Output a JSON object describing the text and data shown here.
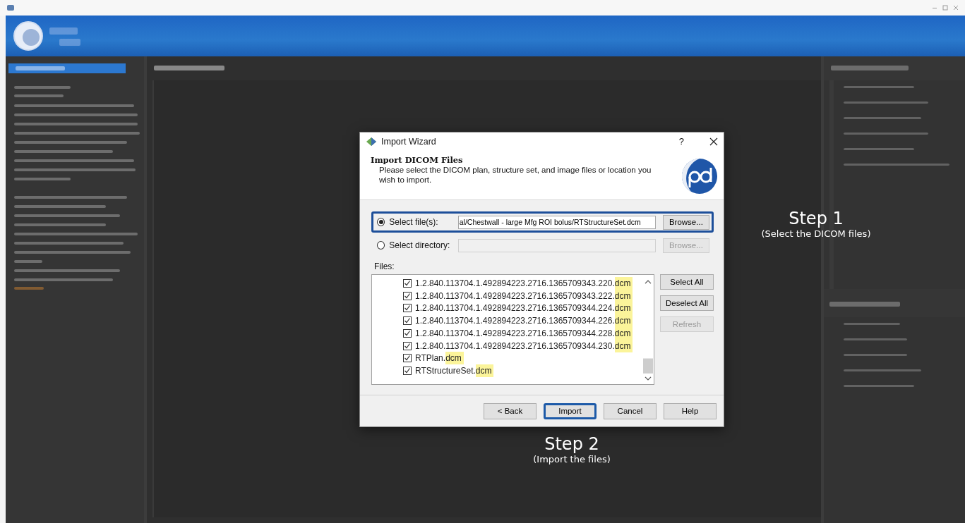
{
  "window": {
    "title": "Import Wizard",
    "help_glyph": "?"
  },
  "header": {
    "title": "Import DICOM Files",
    "description": "Please select the DICOM plan, structure set, and image files or location you wish to import."
  },
  "sources": [
    {
      "label": "Select file(s):",
      "selected": true,
      "value": "al/Chestwall - large Mfg ROI bolus/RTStructureSet.dcm",
      "browse": "Browse...",
      "disabled": false,
      "outlined": true
    },
    {
      "label": "Select directory:",
      "selected": false,
      "browse": "Browse...",
      "disabled": true,
      "outlined": false
    }
  ],
  "files_label": "Files:",
  "files": [
    {
      "name": "1.2.840.113704.1.492894223.2716.1365709343.220.",
      "highlight": "dcm",
      "checked": true
    },
    {
      "name": "1.2.840.113704.1.492894223.2716.1365709343.222.",
      "highlight": "dcm",
      "checked": true
    },
    {
      "name": "1.2.840.113704.1.492894223.2716.1365709344.224.",
      "highlight": "dcm",
      "checked": true
    },
    {
      "name": "1.2.840.113704.1.492894223.2716.1365709344.226.",
      "highlight": "dcm",
      "checked": true
    },
    {
      "name": "1.2.840.113704.1.492894223.2716.1365709344.228.",
      "highlight": "dcm",
      "checked": true
    },
    {
      "name": "1.2.840.113704.1.492894223.2716.1365709344.230.",
      "highlight": "dcm",
      "checked": true
    },
    {
      "name": "RTPlan.",
      "highlight": "dcm",
      "checked": true
    },
    {
      "name": "RTStructureSet.",
      "highlight": "dcm",
      "checked": true
    }
  ],
  "list_buttons": [
    {
      "label": "Select All",
      "disabled": false
    },
    {
      "label": "Deselect All",
      "disabled": false
    },
    {
      "label": "Refresh",
      "disabled": true
    }
  ],
  "footer_buttons": [
    {
      "label": "< Back",
      "default": false
    },
    {
      "label": "Import",
      "default": true
    },
    {
      "label": "Cancel",
      "default": false
    },
    {
      "label": "Help",
      "default": false
    }
  ],
  "annotations": [
    {
      "title": "Step 1",
      "subtitle": "(Select the DICOM files)"
    },
    {
      "title": "Step 2",
      "subtitle": "(Import the files)"
    }
  ]
}
